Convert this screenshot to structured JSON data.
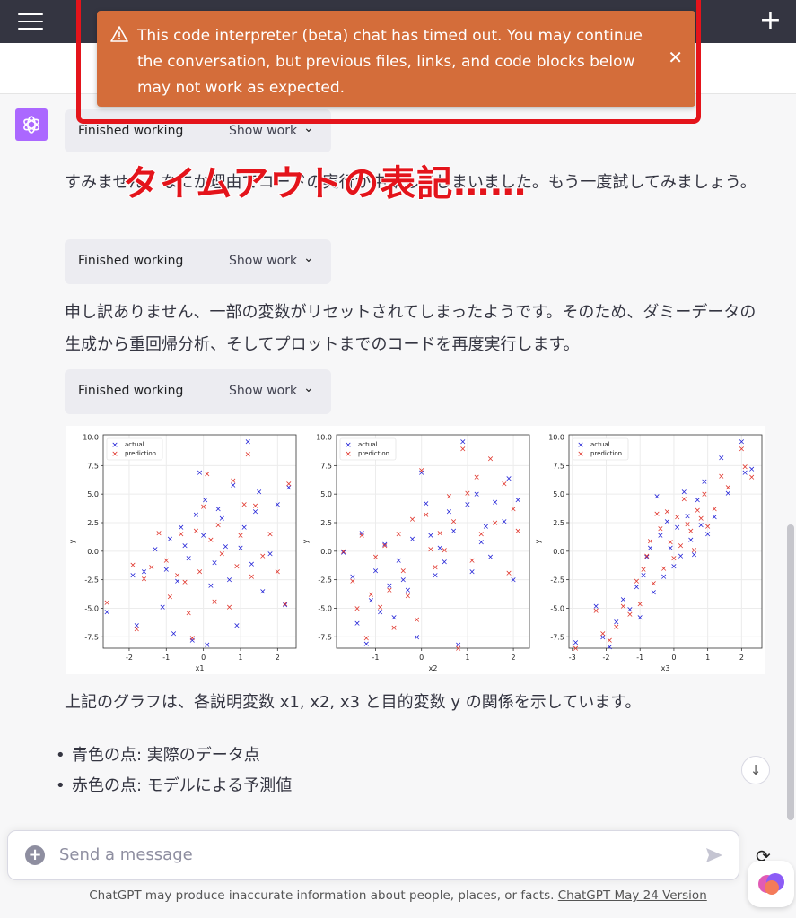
{
  "toast": {
    "message": "This code interpreter (beta) chat has timed out. You may continue the conversation, but previous files, links, and code blocks below may not work as expected.",
    "close": "✕"
  },
  "overlay": {
    "caption": "タイムアウトの表記……"
  },
  "work_blocks": [
    {
      "label": "Finished working",
      "show": "Show work"
    },
    {
      "label": "Finished working",
      "show": "Show work"
    },
    {
      "label": "Finished working",
      "show": "Show work"
    }
  ],
  "messages": {
    "p1": "すみません、なにか理由でコードの実行が中断してしまいました。もう一度試してみましょう。",
    "p2": "申し訳ありません、一部の変数がリセットされてしまったようです。そのため、ダミーデータの生成から重回帰分析、そしてプロットまでのコードを再度実行します。",
    "p3": "上記のグラフは、各説明変数 x1, x2, x3 と目的変数 y の関係を示しています。"
  },
  "bullets": [
    "青色の点: 実際のデータ点",
    "赤色の点: モデルによる予測値"
  ],
  "input": {
    "placeholder": "Send a message"
  },
  "footer": {
    "text": "ChatGPT may produce inaccurate information about people, places, or facts.",
    "link": "ChatGPT May 24 Version"
  },
  "colors": {
    "actual": "#1f1fd6",
    "prediction": "#e0352b",
    "toast": "#d46d3a"
  },
  "chart_data": [
    {
      "type": "scatter",
      "xlabel": "x1",
      "ylabel": "y",
      "xlim": [
        -2.7,
        2.5
      ],
      "ylim": [
        -8.5,
        10.2
      ],
      "xticks": [
        -2,
        -1,
        0,
        1,
        2
      ],
      "yticks": [
        -7.5,
        -5.0,
        -2.5,
        0.0,
        2.5,
        5.0,
        7.5,
        10.0
      ],
      "legend": [
        "actual",
        "prediction"
      ],
      "legend_position": "top-left",
      "series": [
        {
          "name": "actual",
          "points": [
            [
              -2.6,
              -5.3
            ],
            [
              -1.9,
              -2.1
            ],
            [
              -1.8,
              -6.5
            ],
            [
              -1.6,
              -1.8
            ],
            [
              -1.3,
              0.2
            ],
            [
              -1.1,
              -4.9
            ],
            [
              -1.0,
              -1.6
            ],
            [
              -0.9,
              1.1
            ],
            [
              -0.8,
              -7.2
            ],
            [
              -0.7,
              -2.6
            ],
            [
              -0.6,
              2.1
            ],
            [
              -0.5,
              0.5
            ],
            [
              -0.4,
              -0.6
            ],
            [
              -0.3,
              -7.8
            ],
            [
              -0.2,
              3.2
            ],
            [
              -0.1,
              6.9
            ],
            [
              0.0,
              1.4
            ],
            [
              0.05,
              4.5
            ],
            [
              0.1,
              -8.2
            ],
            [
              0.2,
              -3.0
            ],
            [
              0.3,
              -1.0
            ],
            [
              0.4,
              3.7
            ],
            [
              0.5,
              2.9
            ],
            [
              0.6,
              0.4
            ],
            [
              0.7,
              -2.5
            ],
            [
              0.8,
              5.8
            ],
            [
              0.9,
              -6.5
            ],
            [
              1.0,
              0.3
            ],
            [
              1.1,
              2.1
            ],
            [
              1.2,
              9.6
            ],
            [
              1.3,
              -1.1
            ],
            [
              1.4,
              3.5
            ],
            [
              1.5,
              5.2
            ],
            [
              1.6,
              -3.5
            ],
            [
              1.8,
              -0.2
            ],
            [
              2.0,
              4.1
            ],
            [
              2.2,
              -4.7
            ],
            [
              2.3,
              5.6
            ]
          ]
        },
        {
          "name": "prediction",
          "points": [
            [
              -2.6,
              -4.5
            ],
            [
              -1.9,
              -1.2
            ],
            [
              -1.8,
              -6.8
            ],
            [
              -1.6,
              -2.4
            ],
            [
              -1.4,
              -1.4
            ],
            [
              -1.2,
              1.6
            ],
            [
              -1.0,
              -0.8
            ],
            [
              -0.9,
              -4.0
            ],
            [
              -0.7,
              -2.1
            ],
            [
              -0.6,
              1.5
            ],
            [
              -0.5,
              -2.7
            ],
            [
              -0.4,
              -5.4
            ],
            [
              -0.3,
              -7.6
            ],
            [
              -0.2,
              1.8
            ],
            [
              -0.1,
              -1.8
            ],
            [
              0.0,
              3.9
            ],
            [
              0.1,
              6.8
            ],
            [
              0.2,
              1.0
            ],
            [
              0.3,
              -4.4
            ],
            [
              0.4,
              2.3
            ],
            [
              0.5,
              -0.2
            ],
            [
              0.7,
              -4.9
            ],
            [
              0.8,
              6.2
            ],
            [
              0.9,
              -1.3
            ],
            [
              1.0,
              1.4
            ],
            [
              1.1,
              4.1
            ],
            [
              1.2,
              8.5
            ],
            [
              1.3,
              -2.2
            ],
            [
              1.4,
              4.0
            ],
            [
              1.6,
              -0.4
            ],
            [
              1.8,
              1.5
            ],
            [
              2.0,
              -1.8
            ],
            [
              2.2,
              -4.6
            ],
            [
              2.3,
              5.9
            ]
          ]
        }
      ]
    },
    {
      "type": "scatter",
      "xlabel": "x2",
      "ylabel": "y",
      "xlim": [
        -1.85,
        2.35
      ],
      "ylim": [
        -8.5,
        10.2
      ],
      "xticks": [
        -1,
        0,
        1,
        2
      ],
      "yticks": [
        -7.5,
        -5.0,
        -2.5,
        0.0,
        2.5,
        5.0,
        7.5,
        10.0
      ],
      "legend": [
        "actual",
        "prediction"
      ],
      "legend_position": "top-left",
      "series": [
        {
          "name": "actual",
          "points": [
            [
              -1.7,
              -0.1
            ],
            [
              -1.5,
              -2.2
            ],
            [
              -1.4,
              -6.3
            ],
            [
              -1.3,
              1.6
            ],
            [
              -1.2,
              -8.1
            ],
            [
              -1.1,
              -4.3
            ],
            [
              -1.0,
              -1.7
            ],
            [
              -0.9,
              -5.3
            ],
            [
              -0.8,
              0.6
            ],
            [
              -0.7,
              -3.0
            ],
            [
              -0.6,
              -5.8
            ],
            [
              -0.5,
              -0.8
            ],
            [
              -0.4,
              -2.5
            ],
            [
              -0.3,
              -3.4
            ],
            [
              -0.2,
              1.1
            ],
            [
              -0.1,
              -7.5
            ],
            [
              0.0,
              6.9
            ],
            [
              0.1,
              4.2
            ],
            [
              0.2,
              1.4
            ],
            [
              0.3,
              -2.1
            ],
            [
              0.4,
              0.3
            ],
            [
              0.5,
              -0.9
            ],
            [
              0.6,
              3.5
            ],
            [
              0.7,
              1.8
            ],
            [
              0.8,
              -8.2
            ],
            [
              0.9,
              9.6
            ],
            [
              1.0,
              4.1
            ],
            [
              1.1,
              -1.8
            ],
            [
              1.2,
              5.0
            ],
            [
              1.3,
              0.8
            ],
            [
              1.4,
              2.2
            ],
            [
              1.5,
              -0.5
            ],
            [
              1.6,
              4.3
            ],
            [
              1.8,
              2.6
            ],
            [
              1.9,
              6.4
            ],
            [
              2.0,
              -2.5
            ],
            [
              2.1,
              4.5
            ]
          ]
        },
        {
          "name": "prediction",
          "points": [
            [
              -1.7,
              0.0
            ],
            [
              -1.5,
              -2.6
            ],
            [
              -1.4,
              -5.0
            ],
            [
              -1.3,
              1.4
            ],
            [
              -1.2,
              -7.6
            ],
            [
              -1.1,
              -3.8
            ],
            [
              -1.0,
              -0.5
            ],
            [
              -0.9,
              -4.9
            ],
            [
              -0.8,
              0.5
            ],
            [
              -0.7,
              -3.4
            ],
            [
              -0.6,
              -6.7
            ],
            [
              -0.5,
              1.5
            ],
            [
              -0.4,
              -1.7
            ],
            [
              -0.3,
              -3.9
            ],
            [
              -0.2,
              2.8
            ],
            [
              -0.1,
              -6.0
            ],
            [
              0.0,
              7.1
            ],
            [
              0.1,
              3.2
            ],
            [
              0.2,
              0.2
            ],
            [
              0.3,
              -1.4
            ],
            [
              0.4,
              1.6
            ],
            [
              0.5,
              0.1
            ],
            [
              0.6,
              4.8
            ],
            [
              0.7,
              2.6
            ],
            [
              0.8,
              -8.5
            ],
            [
              0.9,
              9.0
            ],
            [
              1.0,
              5.1
            ],
            [
              1.1,
              -0.8
            ],
            [
              1.2,
              6.5
            ],
            [
              1.3,
              1.5
            ],
            [
              1.5,
              8.1
            ],
            [
              1.6,
              2.5
            ],
            [
              1.8,
              5.9
            ],
            [
              1.9,
              -1.9
            ],
            [
              2.0,
              3.7
            ],
            [
              2.1,
              1.8
            ]
          ]
        }
      ]
    },
    {
      "type": "scatter",
      "xlabel": "x3",
      "ylabel": "y",
      "xlim": [
        -3.1,
        2.6
      ],
      "ylim": [
        -8.5,
        10.2
      ],
      "xticks": [
        -3,
        -2,
        -1,
        0,
        1,
        2
      ],
      "yticks": [
        -7.5,
        -5.0,
        -2.5,
        0.0,
        2.5,
        5.0,
        7.5,
        10.0
      ],
      "legend": [
        "actual",
        "prediction"
      ],
      "legend_position": "top-left",
      "series": [
        {
          "name": "actual",
          "points": [
            [
              -2.9,
              -8.0
            ],
            [
              -2.3,
              -4.8
            ],
            [
              -2.1,
              -7.5
            ],
            [
              -1.9,
              -8.4
            ],
            [
              -1.7,
              -6.2
            ],
            [
              -1.5,
              -4.2
            ],
            [
              -1.3,
              -5.1
            ],
            [
              -1.1,
              -3.1
            ],
            [
              -1.0,
              -5.8
            ],
            [
              -0.9,
              -2.1
            ],
            [
              -0.8,
              -0.5
            ],
            [
              -0.7,
              0.3
            ],
            [
              -0.6,
              -3.6
            ],
            [
              -0.5,
              4.8
            ],
            [
              -0.4,
              1.4
            ],
            [
              -0.3,
              -2.2
            ],
            [
              -0.2,
              2.6
            ],
            [
              -0.1,
              0.3
            ],
            [
              0.0,
              -1.3
            ],
            [
              0.1,
              2.1
            ],
            [
              0.2,
              -0.4
            ],
            [
              0.3,
              5.2
            ],
            [
              0.4,
              3.1
            ],
            [
              0.5,
              1.0
            ],
            [
              0.6,
              -0.3
            ],
            [
              0.7,
              4.5
            ],
            [
              0.8,
              2.3
            ],
            [
              0.9,
              6.1
            ],
            [
              1.0,
              1.5
            ],
            [
              1.2,
              3.0
            ],
            [
              1.4,
              8.2
            ],
            [
              1.6,
              5.1
            ],
            [
              2.0,
              9.6
            ],
            [
              2.1,
              6.9
            ],
            [
              2.3,
              7.2
            ]
          ]
        },
        {
          "name": "prediction",
          "points": [
            [
              -2.9,
              -8.5
            ],
            [
              -2.3,
              -5.2
            ],
            [
              -2.1,
              -7.2
            ],
            [
              -1.9,
              -7.8
            ],
            [
              -1.7,
              -6.6
            ],
            [
              -1.5,
              -4.8
            ],
            [
              -1.3,
              -5.5
            ],
            [
              -1.1,
              -2.6
            ],
            [
              -1.0,
              -4.6
            ],
            [
              -0.9,
              -1.6
            ],
            [
              -0.8,
              -0.4
            ],
            [
              -0.7,
              0.9
            ],
            [
              -0.6,
              -2.8
            ],
            [
              -0.5,
              3.3
            ],
            [
              -0.4,
              2.0
            ],
            [
              -0.3,
              -1.5
            ],
            [
              -0.2,
              3.5
            ],
            [
              -0.1,
              0.8
            ],
            [
              0.0,
              -0.6
            ],
            [
              0.1,
              3.0
            ],
            [
              0.2,
              0.5
            ],
            [
              0.3,
              4.6
            ],
            [
              0.4,
              2.4
            ],
            [
              0.5,
              1.8
            ],
            [
              0.6,
              0.1
            ],
            [
              0.7,
              3.6
            ],
            [
              0.8,
              2.9
            ],
            [
              0.9,
              5.0
            ],
            [
              1.0,
              2.2
            ],
            [
              1.2,
              3.7
            ],
            [
              1.4,
              6.6
            ],
            [
              1.6,
              5.6
            ],
            [
              2.0,
              9.0
            ],
            [
              2.1,
              7.4
            ],
            [
              2.3,
              6.5
            ]
          ]
        }
      ]
    }
  ]
}
